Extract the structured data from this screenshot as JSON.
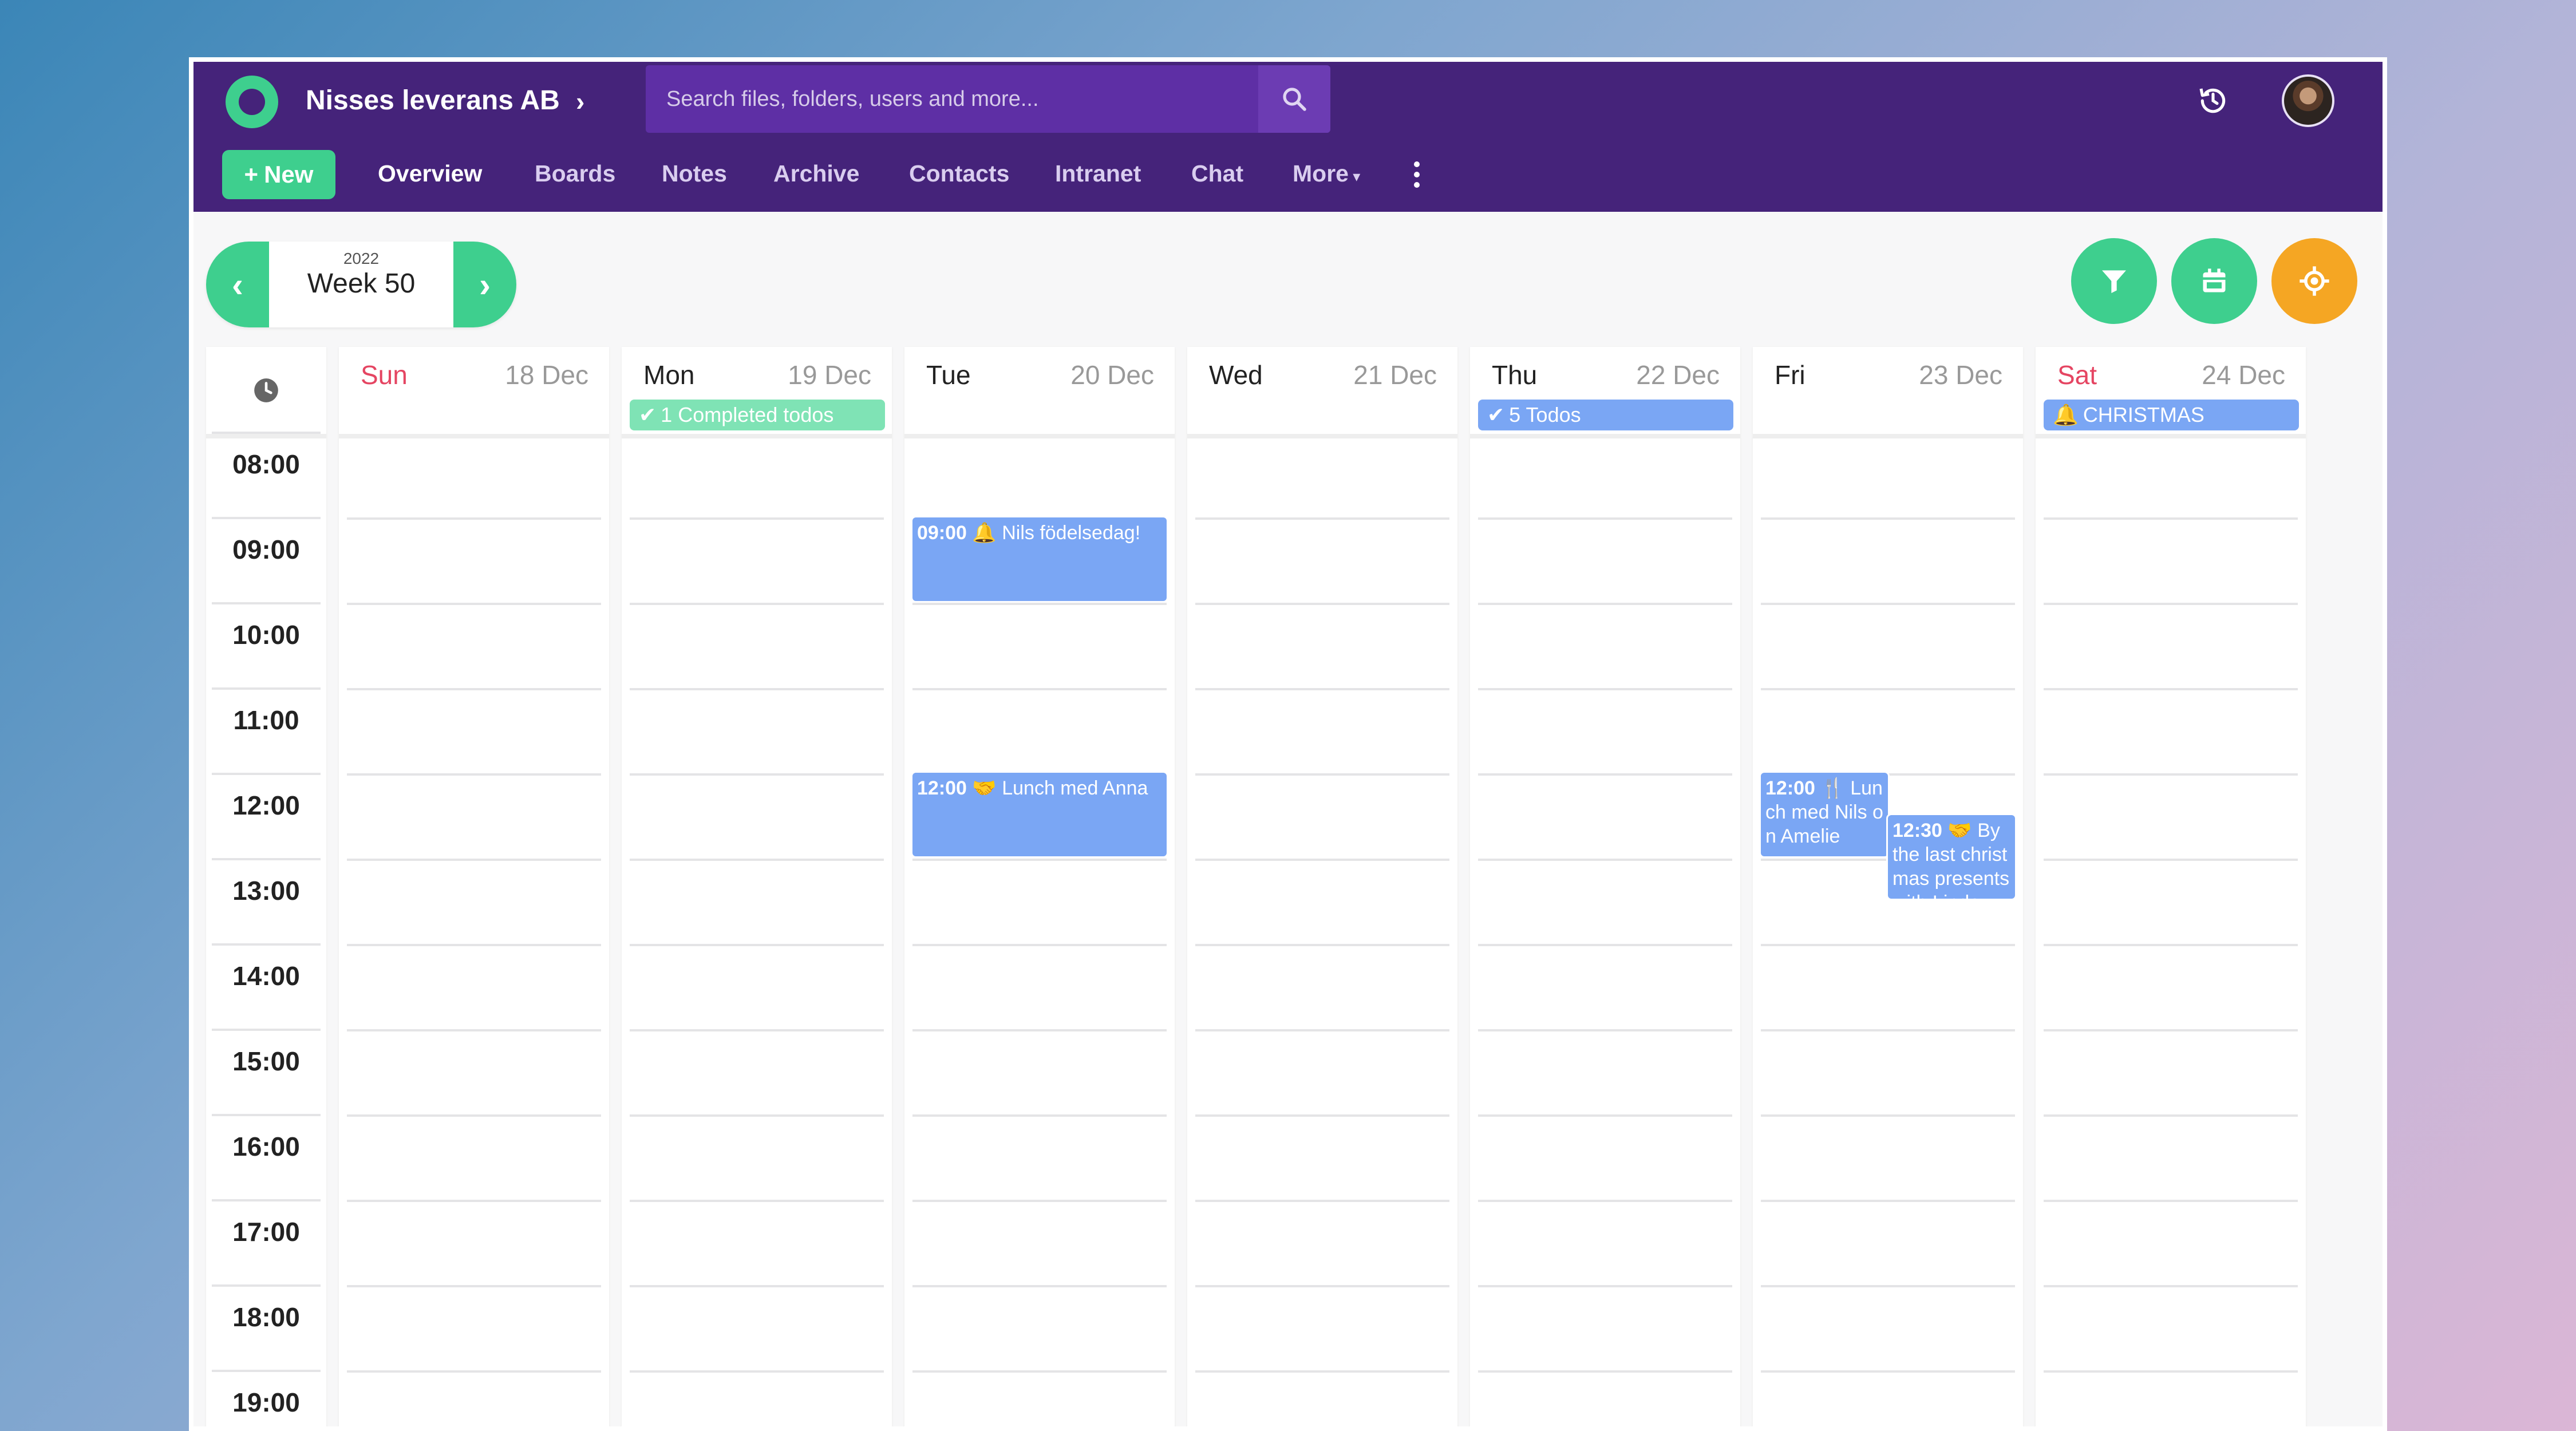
{
  "header": {
    "org_name": "Nisses leverans AB",
    "search_placeholder": "Search files, folders, users and more...",
    "new_label": "New",
    "nav": [
      "Overview",
      "Boards",
      "Notes",
      "Archive",
      "Contacts",
      "Intranet",
      "Chat",
      "More"
    ]
  },
  "week": {
    "year": "2022",
    "label": "Week 50"
  },
  "times": [
    "08:00",
    "09:00",
    "10:00",
    "11:00",
    "12:00",
    "13:00",
    "14:00",
    "15:00",
    "16:00",
    "17:00",
    "18:00",
    "19:00"
  ],
  "days": [
    {
      "name": "Sun",
      "date": "18 Dec",
      "weekend": true
    },
    {
      "name": "Mon",
      "date": "19 Dec",
      "badge": "1 Completed todos"
    },
    {
      "name": "Tue",
      "date": "20 Dec"
    },
    {
      "name": "Wed",
      "date": "21 Dec"
    },
    {
      "name": "Thu",
      "date": "22 Dec",
      "badge": "5 Todos"
    },
    {
      "name": "Fri",
      "date": "23 Dec"
    },
    {
      "name": "Sat",
      "date": "24 Dec",
      "weekend": true,
      "badge": "CHRISTMAS"
    }
  ],
  "events": [
    {
      "time": "09:00",
      "title": "Nils födelsedag!",
      "icon": "bell-icon"
    },
    {
      "time": "12:00",
      "title": "Lunch med Anna",
      "icon": "handshake-icon"
    },
    {
      "time": "12:00",
      "title": "Lunch med Nils on Amelie",
      "icon": "utensils-icon"
    },
    {
      "time": "12:30",
      "title": "By the last christmas presents with Linda",
      "icon": "handshake-icon"
    }
  ],
  "help_label": "?",
  "colors": {
    "topbar": "#45237a",
    "accent_green": "#3ecf8e",
    "accent_orange": "#f5a623",
    "event_blue": "#7aa6f4",
    "weekend_red": "#e54562"
  }
}
